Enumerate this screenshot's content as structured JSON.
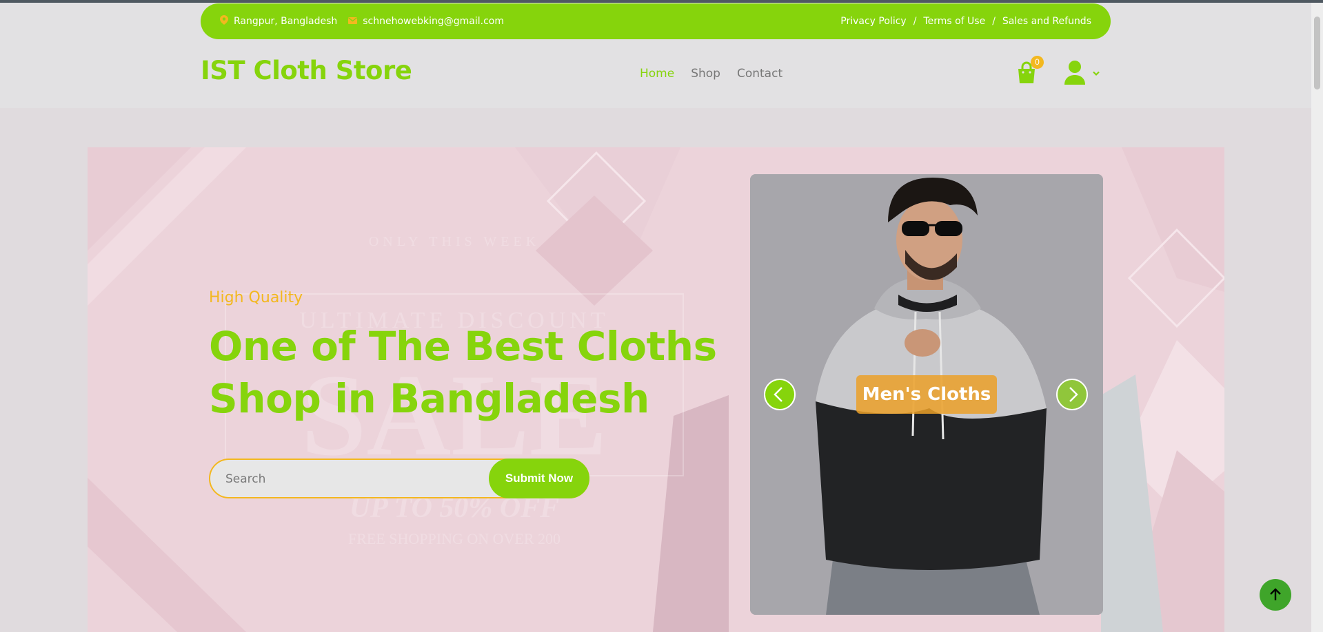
{
  "topbar": {
    "location": "Rangpur, Bangladesh",
    "email": "schnehowebking@gmail.com",
    "links": [
      "Privacy Policy",
      "Terms of Use",
      "Sales and Refunds"
    ],
    "separator": "/"
  },
  "header": {
    "logo": "IST Cloth Store",
    "nav": [
      "Home",
      "Shop",
      "Contact"
    ],
    "active_nav": "Home",
    "cart_count": "0"
  },
  "hero": {
    "eyebrow": "High Quality",
    "headline_line1": "One of The Best Cloths",
    "headline_line2": "Shop in Bangladesh",
    "search_placeholder": "Search",
    "submit_label": "Submit Now",
    "bg_text": {
      "line1": "ONLY THIS WEEK",
      "line2": "ULTIMATE DISCOUNT",
      "line3": "SALE",
      "line4": "UP TO 50% OFF",
      "line5": "FREE SHOPPING ON OVER 200"
    }
  },
  "carousel": {
    "caption": "Men's Cloths"
  },
  "icons": {
    "location": "map-pin-icon",
    "email": "envelope-icon",
    "cart": "shopping-bag-icon",
    "user": "user-icon",
    "prev": "chevron-left-icon",
    "next": "chevron-right-icon",
    "to_top": "arrow-up-icon"
  },
  "colors": {
    "brand_green": "#86d40c",
    "accent_yellow": "#f3b81f",
    "page_bg": "#e2e1e3",
    "hero_pink": "#ecd3da"
  }
}
